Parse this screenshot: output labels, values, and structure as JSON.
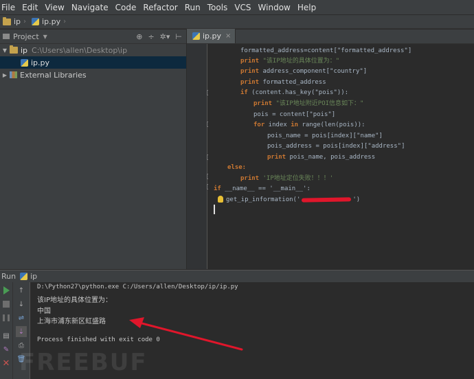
{
  "menubar": [
    "File",
    "Edit",
    "View",
    "Navigate",
    "Code",
    "Refactor",
    "Run",
    "Tools",
    "VCS",
    "Window",
    "Help"
  ],
  "navbar": {
    "project": "ip",
    "file": "ip.py"
  },
  "project_panel": {
    "title": "Project",
    "root_name": "ip",
    "root_path": "C:\\Users\\allen\\Desktop\\ip",
    "file": "ip.py",
    "libraries": "External Libraries"
  },
  "editor": {
    "tab": "ip.py",
    "lines": {
      "l1": "formatted_address=content[\"formatted_address\"]",
      "l2_str": "\"该IP地址的具体位置为：\"",
      "l3": " address_component[\"country\"]",
      "l4": " formatted_address",
      "l5": " (content.has_key(\"pois\")):",
      "l6_str": "\"该IP地址附近POI信息如下：\"",
      "l7": "pois = content[\"pois\"]",
      "l8a": " index ",
      "l8b": " range(len(pois)):",
      "l9": "pois_name = pois[index][\"name\"]",
      "l10": "pois_address = pois[index][\"address\"]",
      "l11": " pois_name, pois_address",
      "l12": "else:",
      "l13_str": "'IP地址定位失败！！！'",
      "l14": " __name__ == '__main__':",
      "l15a": "get_ip_information('",
      "l15b": "')"
    },
    "keywords": {
      "print": "print",
      "if": "if",
      "for": "for",
      "in": "in"
    }
  },
  "run_panel": {
    "title": "Run",
    "config": "ip",
    "output": {
      "cmd": "D:\\Python27\\python.exe C:/Users/allen/Desktop/ip/ip.py",
      "line1": "该IP地址的具体位置为：",
      "line2": "中国",
      "line3": "上海市浦东新区虹盛路",
      "exit": "Process finished with exit code 0"
    }
  },
  "watermark": "FREEBUF",
  "colors": {
    "keyword": "#cc7832",
    "string": "#6a8759",
    "annotation_arrow": "#e0162b"
  }
}
